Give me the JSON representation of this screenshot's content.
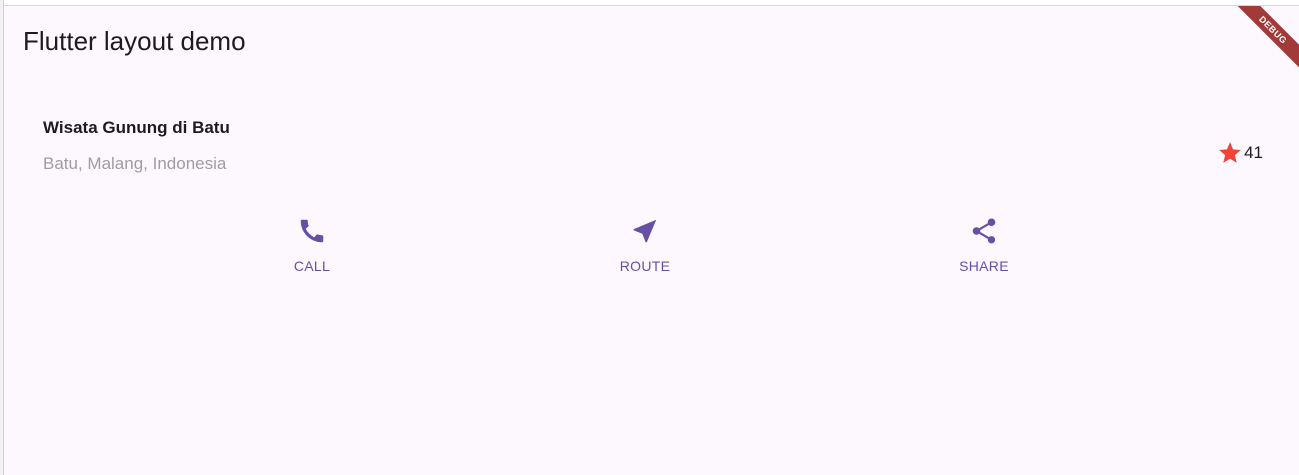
{
  "app_bar": {
    "title": "Flutter layout demo",
    "debug_banner": "DEBUG"
  },
  "title_section": {
    "name": "Wisata Gunung di Batu",
    "location": "Batu, Malang, Indonesia",
    "rating": {
      "icon": "star-icon",
      "count": "41"
    }
  },
  "buttons": [
    {
      "label": "CALL",
      "icon": "phone-icon"
    },
    {
      "label": "ROUTE",
      "icon": "navigation-icon"
    },
    {
      "label": "SHARE",
      "icon": "share-icon"
    }
  ],
  "colors": {
    "background": "#fdf7fe",
    "accent": "#6750a4",
    "star": "#f44336",
    "debug_banner": "#a33a3a",
    "secondary_text": "#9e9e9e"
  }
}
